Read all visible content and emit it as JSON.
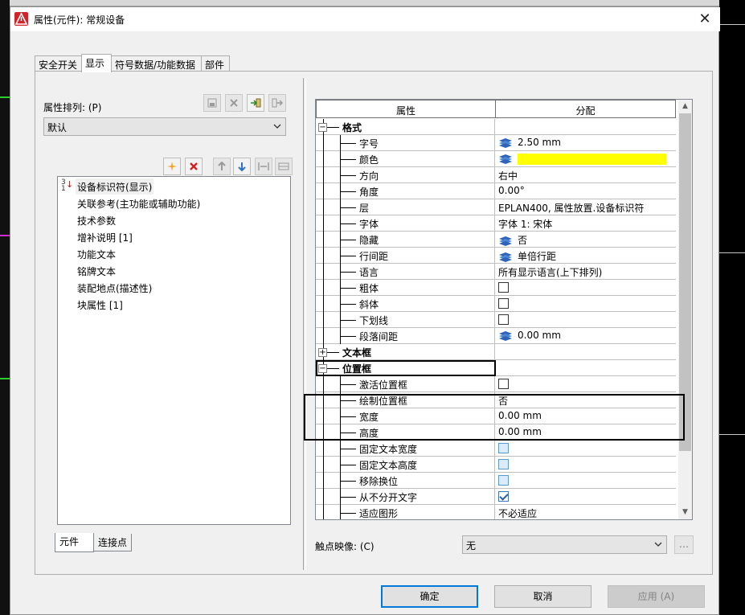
{
  "window": {
    "title": "属性(元件): 常规设备",
    "close_glyph": "✕"
  },
  "tabs": [
    {
      "label": "安全开关",
      "active": false
    },
    {
      "label": "显示",
      "active": true
    },
    {
      "label": "符号数据/功能数据",
      "active": false
    },
    {
      "label": "部件",
      "active": false
    }
  ],
  "left": {
    "sort_label": "属性排列: (P)",
    "sort_value": "默认",
    "items": [
      "设备标识符(显示)",
      "关联参考(主功能或辅助功能)",
      "技术参数",
      "增补说明 [1]",
      "功能文本",
      "铭牌文本",
      "装配地点(描述性)",
      "块属性 [1]"
    ],
    "bottom_tabs": [
      "元件",
      "连接点"
    ]
  },
  "grid": {
    "col_property": "属性",
    "col_value": "分配",
    "rows": [
      {
        "type": "cat",
        "name": "格式",
        "expanded": true
      },
      {
        "type": "prop",
        "name": "字号",
        "value": "2.50 mm",
        "icon": "layers"
      },
      {
        "type": "prop",
        "name": "颜色",
        "value": "",
        "icon": "layers",
        "swatch": "#ffff00"
      },
      {
        "type": "prop",
        "name": "方向",
        "value": "右中"
      },
      {
        "type": "prop",
        "name": "角度",
        "value": "0.00°"
      },
      {
        "type": "prop",
        "name": "层",
        "value": "EPLAN400, 属性放置.设备标识符"
      },
      {
        "type": "prop",
        "name": "字体",
        "value": "字体 1: 宋体"
      },
      {
        "type": "prop",
        "name": "隐藏",
        "value": "否",
        "icon": "layers"
      },
      {
        "type": "prop",
        "name": "行间距",
        "value": "单倍行距",
        "icon": "layers"
      },
      {
        "type": "prop",
        "name": "语言",
        "value": "所有显示语言(上下排列)"
      },
      {
        "type": "prop",
        "name": "粗体",
        "checkbox": "unchecked"
      },
      {
        "type": "prop",
        "name": "斜体",
        "checkbox": "unchecked"
      },
      {
        "type": "prop",
        "name": "下划线",
        "checkbox": "unchecked"
      },
      {
        "type": "prop",
        "name": "段落间距",
        "value": "0.00 mm",
        "icon": "layers"
      },
      {
        "type": "cat",
        "name": "文本框",
        "expanded": false
      },
      {
        "type": "cat",
        "name": "位置框",
        "expanded": true
      },
      {
        "type": "prop",
        "name": "激活位置框",
        "checkbox": "unchecked"
      },
      {
        "type": "prop",
        "name": "绘制位置框",
        "value": "否"
      },
      {
        "type": "prop",
        "name": "宽度",
        "value": "0.00 mm"
      },
      {
        "type": "prop",
        "name": "高度",
        "value": "0.00 mm"
      },
      {
        "type": "prop",
        "name": "固定文本宽度",
        "checkbox": "disabled"
      },
      {
        "type": "prop",
        "name": "固定文本高度",
        "checkbox": "disabled"
      },
      {
        "type": "prop",
        "name": "移除换位",
        "checkbox": "disabled"
      },
      {
        "type": "prop",
        "name": "从不分开文字",
        "checkbox": "checked"
      },
      {
        "type": "prop",
        "name": "适应图形",
        "value": "不必适应"
      }
    ]
  },
  "contact": {
    "label": "触点映像: (C)",
    "value": "无",
    "ellipsis": "..."
  },
  "buttons": {
    "ok": "确定",
    "cancel": "取消",
    "apply": "应用 (A)"
  },
  "colors": {
    "accent": "#0078d7",
    "swatch": "#ffff00",
    "brand": "#d2232a"
  }
}
